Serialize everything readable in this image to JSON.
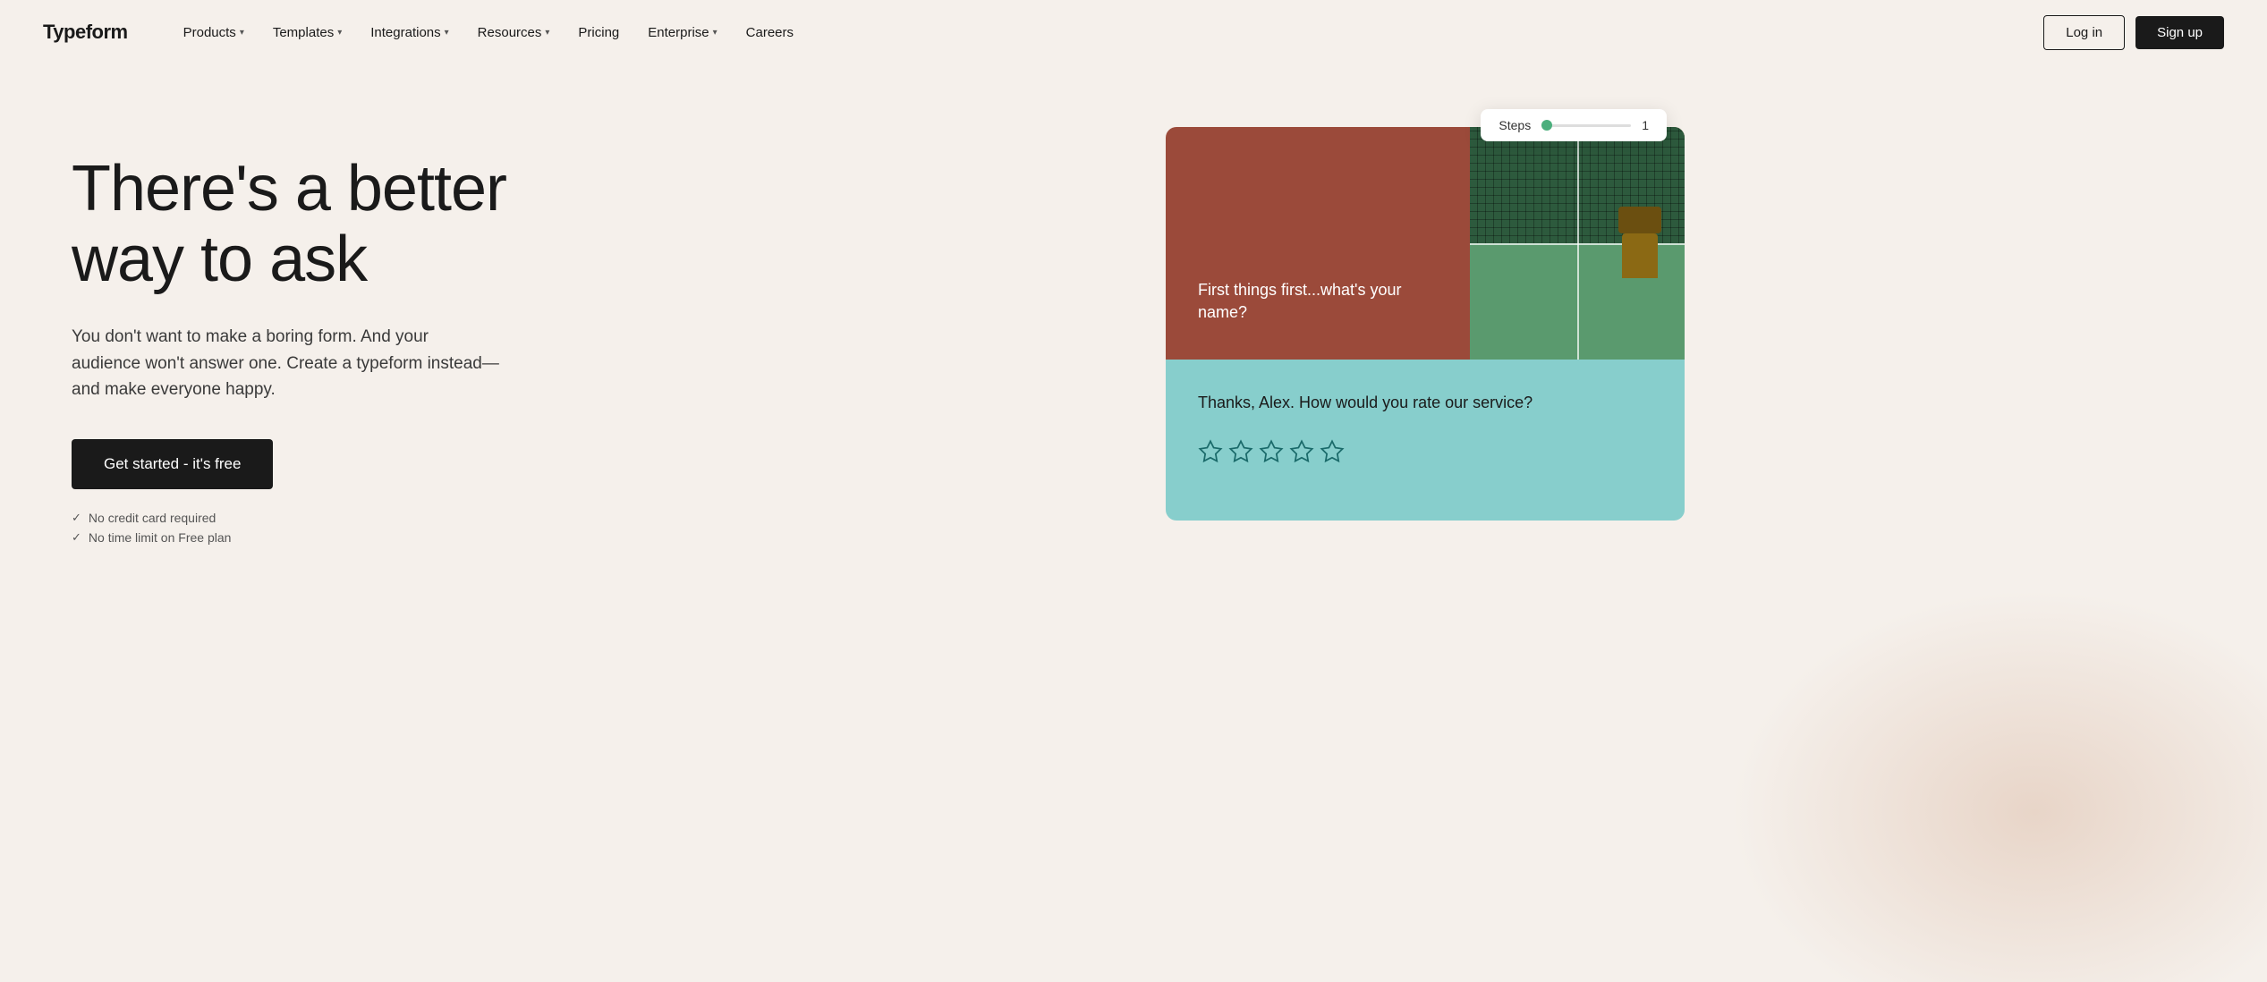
{
  "brand": {
    "name": "Typeform"
  },
  "nav": {
    "items": [
      {
        "label": "Products",
        "hasDropdown": true
      },
      {
        "label": "Templates",
        "hasDropdown": true
      },
      {
        "label": "Integrations",
        "hasDropdown": true
      },
      {
        "label": "Resources",
        "hasDropdown": true
      },
      {
        "label": "Pricing",
        "hasDropdown": false
      },
      {
        "label": "Enterprise",
        "hasDropdown": true
      },
      {
        "label": "Careers",
        "hasDropdown": false
      }
    ],
    "login_label": "Log in",
    "signup_label": "Sign up"
  },
  "hero": {
    "headline": "There's a better way to ask",
    "subtext": "You don't want to make a boring form. And your audience won't answer one. Create a typeform instead—and make everyone happy.",
    "cta_label": "Get started - it's free",
    "checks": [
      "No credit card required",
      "No time limit on Free plan"
    ]
  },
  "form_preview": {
    "steps_label": "Steps",
    "steps_number": "1",
    "top_card_question": "First things first...what's your name?",
    "bottom_card_question": "Thanks, Alex. How would you rate our service?"
  }
}
